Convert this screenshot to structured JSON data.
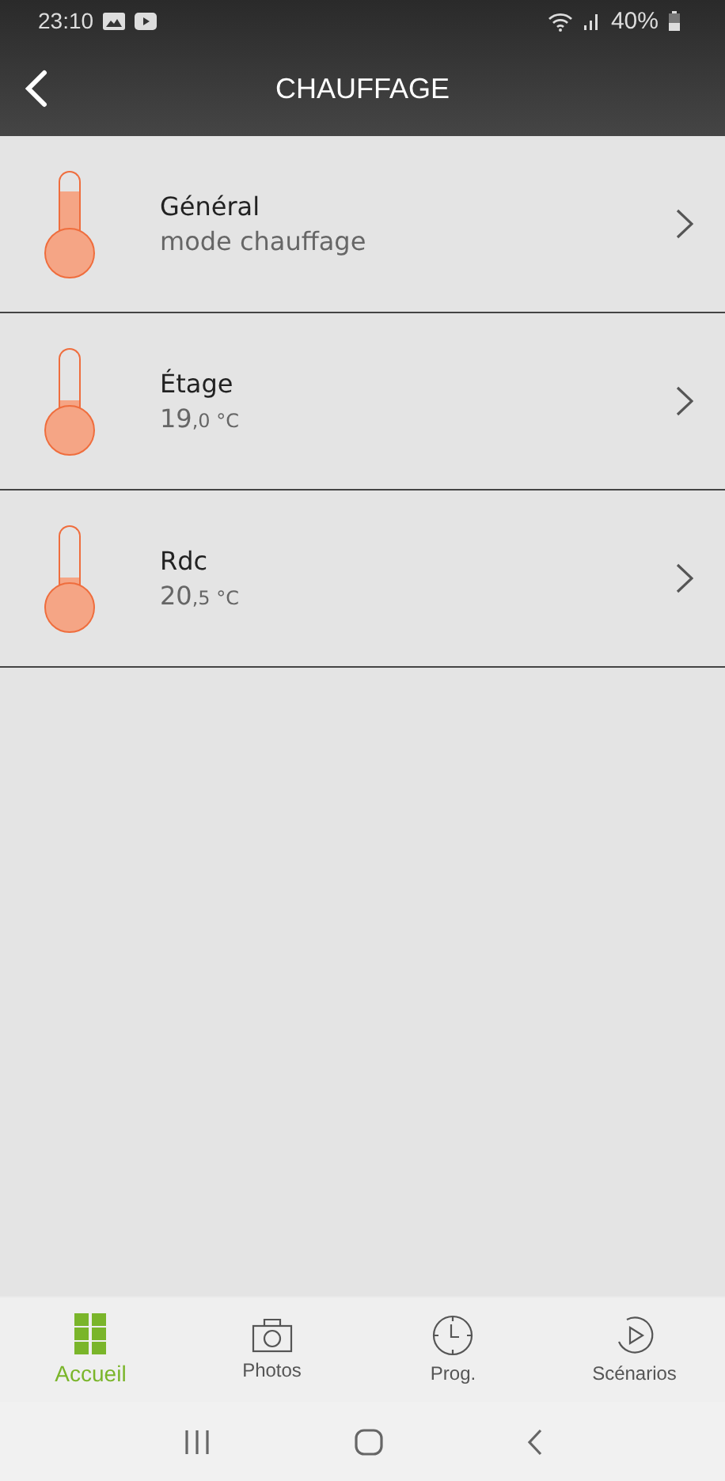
{
  "status_bar": {
    "time": "23:10",
    "battery": "40%"
  },
  "header": {
    "title": "CHAUFFAGE"
  },
  "zones": [
    {
      "name": "Général",
      "subtitle": "mode chauffage",
      "level": 0.7
    },
    {
      "name": "Étage",
      "value": "19",
      "decimals": ",0 °C",
      "level": 0.2
    },
    {
      "name": "Rdc",
      "value": "20",
      "decimals": ",5 °C",
      "level": 0.2
    }
  ],
  "tabs": [
    {
      "kind": "home",
      "label": "Accueil",
      "selected": true
    },
    {
      "kind": "camera",
      "label": "Photos",
      "selected": false
    },
    {
      "kind": "clock",
      "label": "Prog.",
      "selected": false
    },
    {
      "kind": "play",
      "label": "Scénarios",
      "selected": false
    }
  ]
}
